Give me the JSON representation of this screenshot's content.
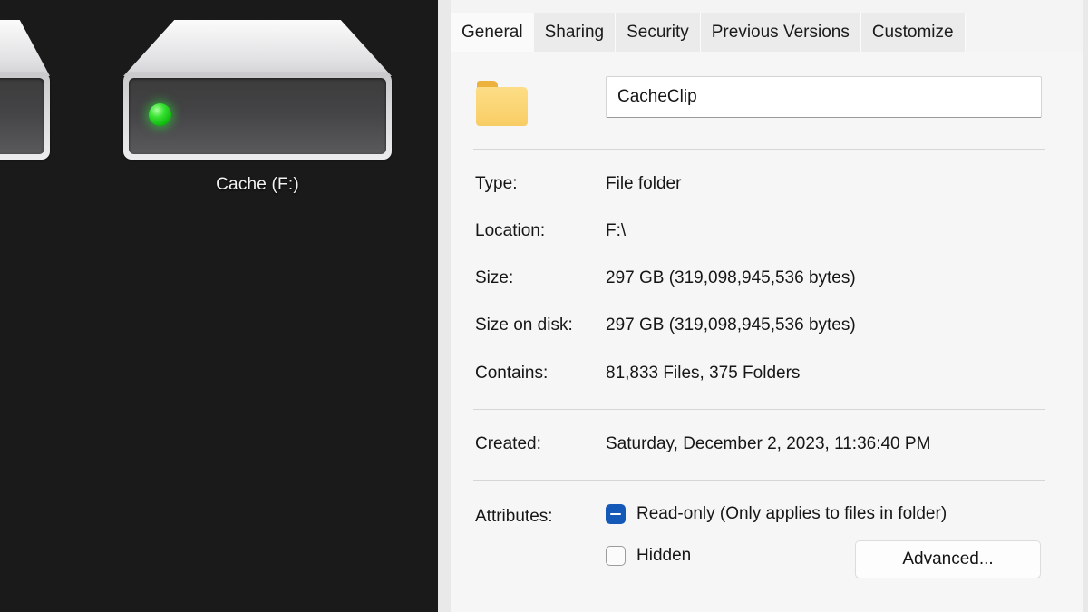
{
  "desktop": {
    "icons": [
      {
        "label": "Cache (F:)",
        "icon": "hard-drive-icon",
        "led_color": "#22cc22"
      },
      {
        "label": "",
        "icon": "hard-drive-icon-cutoff",
        "led_color": "#e9902f"
      }
    ]
  },
  "dialog": {
    "tabs": [
      {
        "label": "General",
        "selected": true
      },
      {
        "label": "Sharing",
        "selected": false
      },
      {
        "label": "Security",
        "selected": false
      },
      {
        "label": "Previous Versions",
        "selected": false
      },
      {
        "label": "Customize",
        "selected": false
      }
    ],
    "folder_icon": "folder-icon",
    "name_field": {
      "value": "CacheClip",
      "placeholder": ""
    },
    "properties": [
      {
        "label": "Type:",
        "value": "File folder"
      },
      {
        "label": "Location:",
        "value": "F:\\"
      },
      {
        "label": "Size:",
        "value": "297 GB (319,098,945,536 bytes)"
      },
      {
        "label": "Size on disk:",
        "value": "297 GB (319,098,945,536 bytes)"
      },
      {
        "label": "Contains:",
        "value": "81,833 Files, 375 Folders"
      }
    ],
    "created": {
      "label": "Created:",
      "value": "Saturday, December 2, 2023, 11:36:40 PM"
    },
    "attributes": {
      "label": "Attributes:",
      "readonly": {
        "text": "Read-only (Only applies to files in folder)",
        "state": "indeterminate"
      },
      "hidden": {
        "text": "Hidden",
        "state": "unchecked"
      },
      "advanced_button": "Advanced..."
    },
    "colors": {
      "accent": "#1459b8",
      "dialog_bg": "#f4f4f4",
      "tab_selected_bg": "#fafafa",
      "tab_bg": "#ebebeb",
      "folder_amber": "#edb23d",
      "folder_yellow": "#fbd574"
    }
  }
}
